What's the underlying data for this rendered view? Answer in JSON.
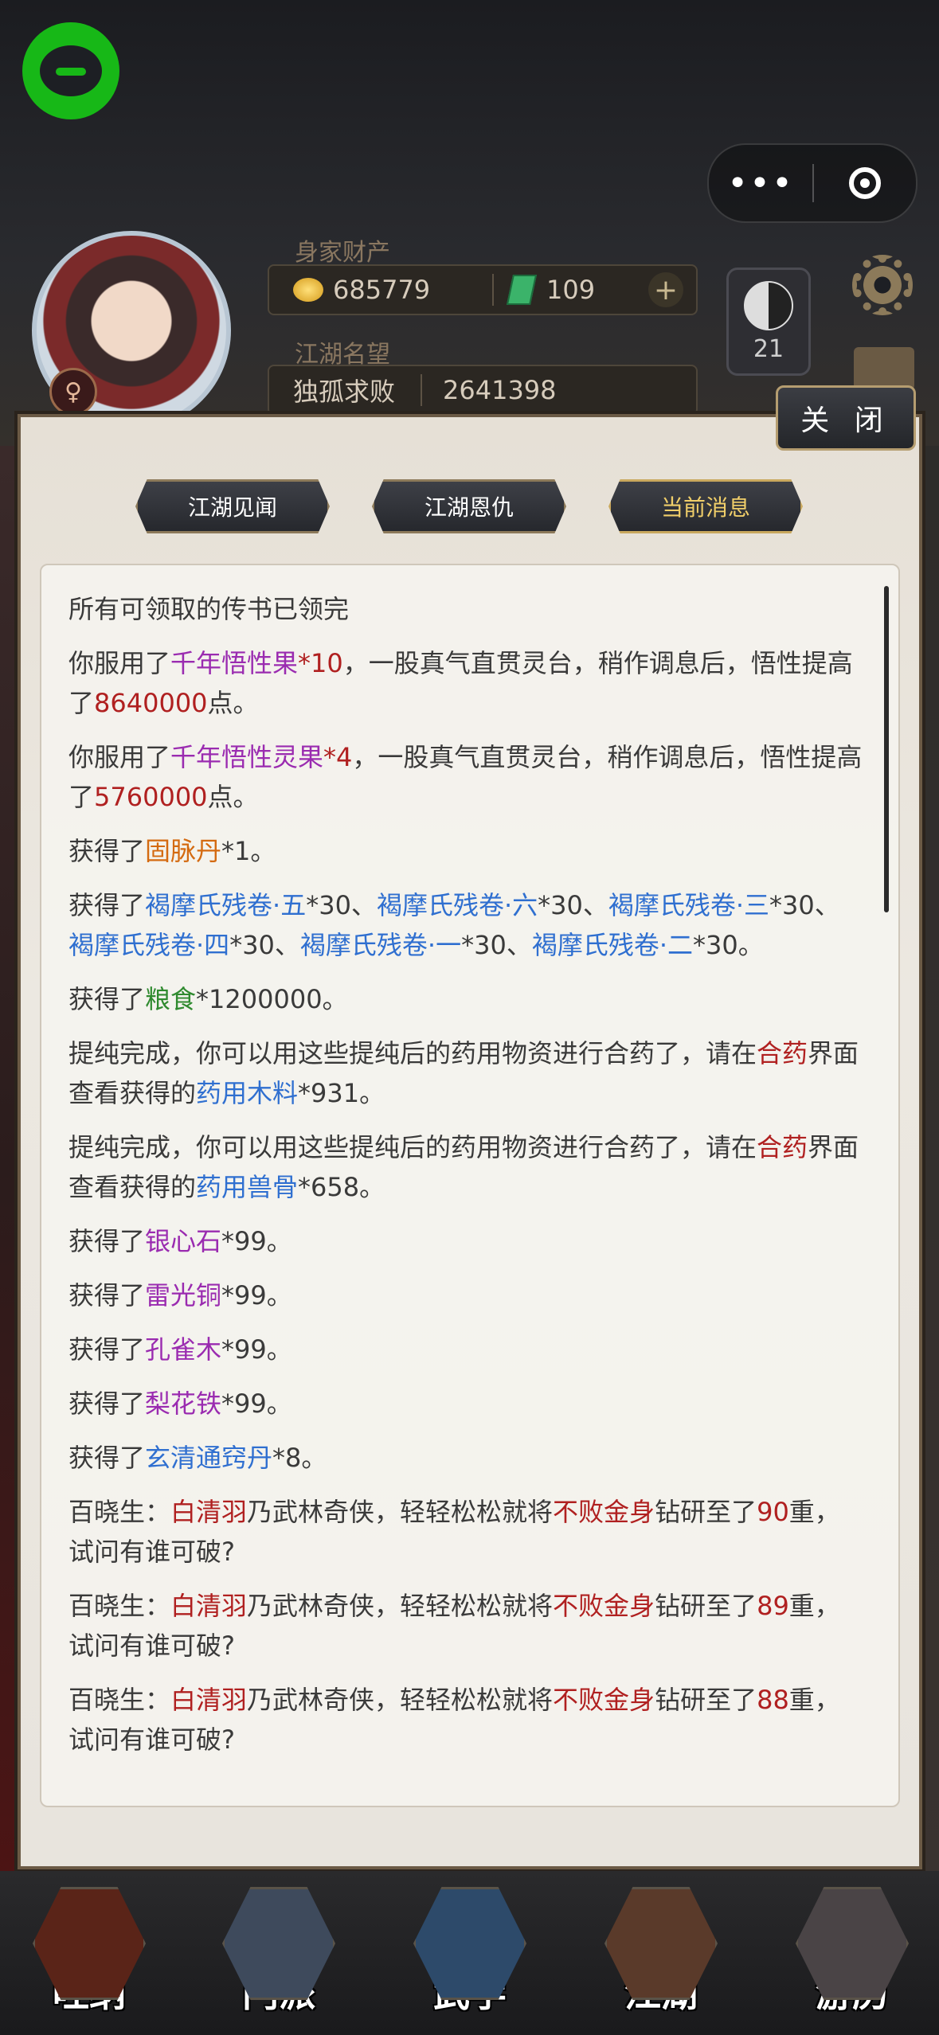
{
  "header": {
    "wealth_label": "身家财产",
    "gold": "685779",
    "jade": "109",
    "plus": "+",
    "fame_label": "江湖名望",
    "title": "独孤求败",
    "fame_value": "2641398",
    "level": "21",
    "gender_symbol": "♀"
  },
  "capsule": {
    "more": "•••"
  },
  "panel": {
    "close_label": "关 闭",
    "tabs": [
      {
        "label": "江湖见闻"
      },
      {
        "label": "江湖恩仇"
      },
      {
        "label": "当前消息"
      }
    ]
  },
  "messages": [
    {
      "t1": "所有可领取的传书已领完"
    },
    {
      "t1": "你服用了",
      "item": "千年悟性果",
      "t2": "*10",
      "t3": "，一股真气直贯灵台，稍作调息后，悟性提高了",
      "num": "8640000",
      "t4": "点。"
    },
    {
      "t1": "你服用了",
      "item": "千年悟性灵果",
      "t2": "*4",
      "t3": "，一股真气直贯灵台，稍作调息后，悟性提高了",
      "num": "5760000",
      "t4": "点。"
    },
    {
      "t1": "获得了",
      "item": "固脉丹",
      "t2": "*1。"
    },
    {
      "t1": "获得了",
      "i1": "褐摩氏残卷·五",
      "a1": "*30、",
      "i2": "褐摩氏残卷·六",
      "a2": "*30、",
      "i3": "褐摩氏残卷·三",
      "a3": "*30、",
      "i4": "褐摩氏残卷·四",
      "a4": "*30、",
      "i5": "褐摩氏残卷·一",
      "a5": "*30、",
      "i6": "褐摩氏残卷·二",
      "a6": "*30。"
    },
    {
      "t1": "获得了",
      "item": "粮食",
      "t2": "*1200000。"
    },
    {
      "t1": "提纯完成，你可以用这些提纯后的药用物资进行合药了，请在",
      "link": "合药",
      "t2": "界面查看获得的",
      "item": "药用木料",
      "t3": "*931。"
    },
    {
      "t1": "提纯完成，你可以用这些提纯后的药用物资进行合药了，请在",
      "link": "合药",
      "t2": "界面查看获得的",
      "item": "药用兽骨",
      "t3": "*658。"
    },
    {
      "t1": "获得了",
      "item": "银心石",
      "t2": "*99。"
    },
    {
      "t1": "获得了",
      "item": "雷光铜",
      "t2": "*99。"
    },
    {
      "t1": "获得了",
      "item": "孔雀木",
      "t2": "*99。"
    },
    {
      "t1": "获得了",
      "item": "梨花铁",
      "t2": "*99。"
    },
    {
      "t1": "获得了",
      "item": "玄清通窍丹",
      "t2": "*8。"
    },
    {
      "t1": "百晓生：",
      "who": "白清羽",
      "t2": "乃武林奇侠，轻轻松松就将",
      "skill": "不败金身",
      "t3": "钻研至了",
      "num": "90",
      "t4": "重，试问有谁可破?"
    },
    {
      "t1": "百晓生：",
      "who": "白清羽",
      "t2": "乃武林奇侠，轻轻松松就将",
      "skill": "不败金身",
      "t3": "钻研至了",
      "num": "89",
      "t4": "重，试问有谁可破?"
    },
    {
      "t1": "百晓生：",
      "who": "白清羽",
      "t2": "乃武林奇侠，轻轻松松就将",
      "skill": "不败金身",
      "t3": "钻研至了",
      "num": "88",
      "t4": "重，试问有谁可破?"
    }
  ],
  "nav": [
    {
      "label": "吐纳"
    },
    {
      "label": "门派"
    },
    {
      "label": "武学"
    },
    {
      "label": "江湖"
    },
    {
      "label": "游历"
    }
  ]
}
